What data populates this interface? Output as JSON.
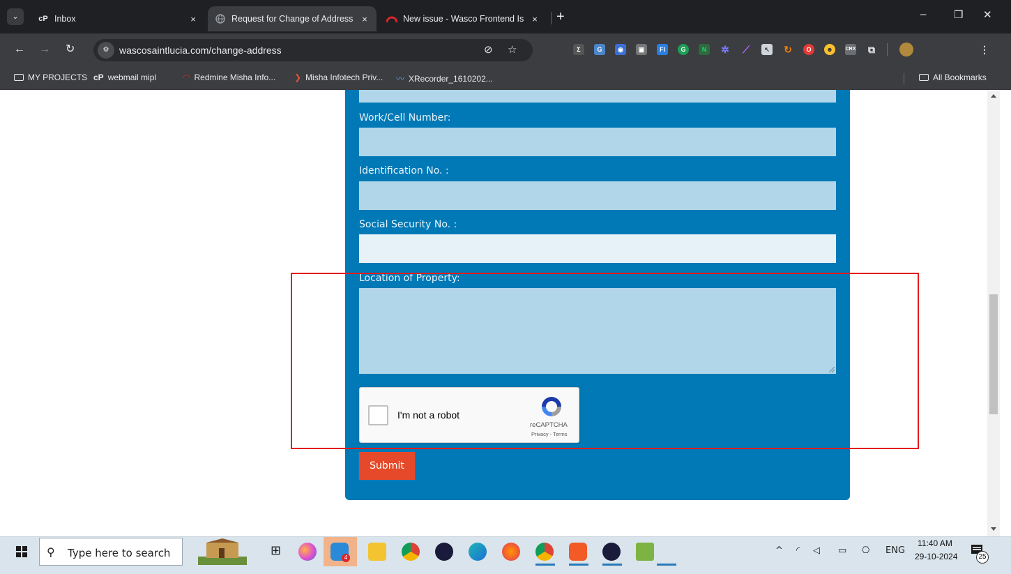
{
  "browser": {
    "tabs": [
      {
        "title": "Inbox",
        "close": "×"
      },
      {
        "title": "Request for Change of Address",
        "close": "×"
      },
      {
        "title": "New issue - Wasco Frontend Iss",
        "close": "×"
      }
    ],
    "new_tab": "+",
    "window_controls": {
      "minimize": "–",
      "restore": "❐",
      "close": "✕"
    },
    "url": "wascosaintlucia.com/change-address",
    "bookmarks": [
      {
        "label": "MY PROJECTS",
        "icon": "folder-icon"
      },
      {
        "label": "webmail mipl",
        "icon": "cpanel-icon"
      },
      {
        "label": "Redmine Misha Info...",
        "icon": "redmine-icon"
      },
      {
        "label": "Misha Infotech Priv...",
        "icon": "misha-icon"
      },
      {
        "label": "XRecorder_1610202...",
        "icon": "xrecorder-icon"
      }
    ],
    "all_bookmarks": "All Bookmarks"
  },
  "form": {
    "fields": [
      {
        "label": "Work/Cell Number:",
        "value": ""
      },
      {
        "label": "Identification No. :",
        "value": ""
      },
      {
        "label": "Social Security No. :",
        "value": ""
      },
      {
        "label": "Location of Property:",
        "value": ""
      }
    ],
    "recaptcha": {
      "label": "I'm not a robot",
      "brand": "reCAPTCHA",
      "links": "Privacy - Terms"
    },
    "submit_label": "Submit"
  },
  "taskbar": {
    "search_placeholder": "Type here to search",
    "language": "ENG",
    "time": "11:40 AM",
    "date": "29-10-2024",
    "notification_count": "25",
    "badge_count": "4"
  },
  "colors": {
    "form_bg": "#0079b6",
    "input_bg": "#b1d6e9",
    "submit_bg": "#e5492a",
    "highlight": "#e51b1b"
  }
}
